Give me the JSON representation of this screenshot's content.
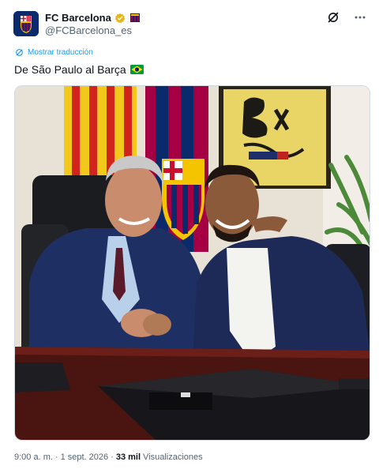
{
  "account": {
    "name": "FC Barcelona",
    "handle": "@FCBarcelona_es"
  },
  "translate_label": "Mostrar traducción",
  "tweet": {
    "text": "De São Paulo al Barça"
  },
  "meta": {
    "time": "9:00 a. m.",
    "separator": "·",
    "date": "1 sept. 2026",
    "views_count": "33 mil",
    "views_label": "Visualizaciones"
  },
  "icons": {
    "verified": "verified-badge-icon",
    "grok": "grok-icon",
    "more": "more-icon",
    "translate": "translate-icon",
    "flag": "brazil-flag-icon"
  },
  "colors": {
    "link_blue": "#1d9bf0",
    "verified_gold": "#e2b719",
    "barca_blue": "#0b2a6b",
    "barca_red": "#a50044"
  }
}
